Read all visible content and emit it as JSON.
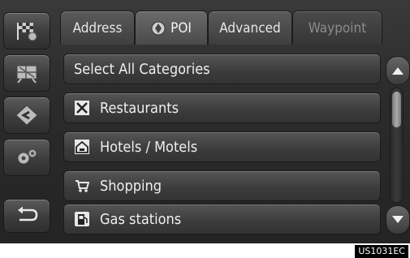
{
  "side_rail": [
    {
      "name": "destination-flag-icon"
    },
    {
      "name": "map-icon"
    },
    {
      "name": "route-diamond-icon"
    },
    {
      "name": "gear-icon"
    },
    {
      "name": "back-arrow-icon"
    }
  ],
  "tabs": [
    {
      "label": "Address",
      "state": "normal"
    },
    {
      "label": "POI",
      "state": "active",
      "icon": "poi-icon"
    },
    {
      "label": "Advanced",
      "state": "normal"
    },
    {
      "label": "Waypoint",
      "state": "disabled"
    }
  ],
  "list": {
    "header": "Select All Categories",
    "items": [
      {
        "label": "Restaurants",
        "icon": "restaurant-icon"
      },
      {
        "label": "Hotels / Motels",
        "icon": "hotel-icon"
      },
      {
        "label": "Shopping",
        "icon": "shopping-icon"
      },
      {
        "label": "Gas stations",
        "icon": "gas-station-icon"
      }
    ]
  },
  "scroll": {
    "position": 0.0
  },
  "figure_code": "US1031EC"
}
